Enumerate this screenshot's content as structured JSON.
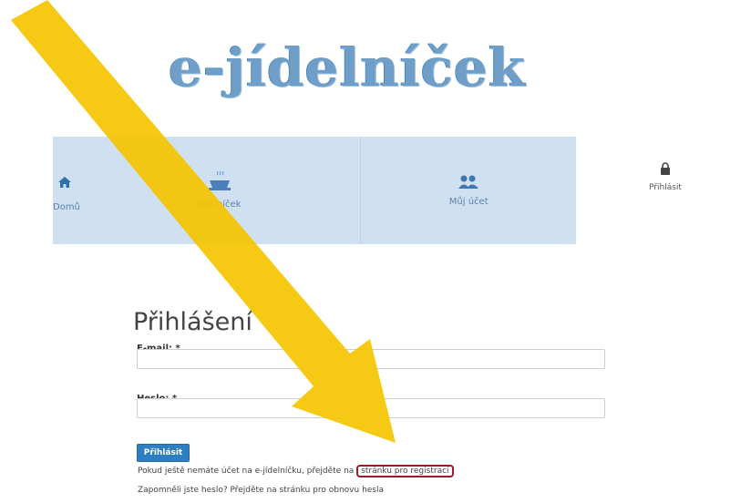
{
  "header": {
    "logo_text": "e-jídelníček"
  },
  "nav": {
    "items": [
      {
        "label": "Domů",
        "icon": "home-icon"
      },
      {
        "label": "Jídelníček",
        "icon": "dish-icon"
      },
      {
        "label": "Můj účet",
        "icon": "users-icon"
      }
    ],
    "login": {
      "label": "Přihlásit",
      "icon": "lock-icon"
    }
  },
  "form": {
    "title": "Přihlášení",
    "email_label": "E-mail: *",
    "email_value": "",
    "password_label": "Heslo: *",
    "password_value": "",
    "submit_label": "Přihlásit"
  },
  "footer": {
    "register_prefix": "Pokud ještě nemáte účet na e-jídelníčku, přejděte na",
    "register_link": "stránku pro registraci",
    "forgot_text": "Zapomněli jste heslo? Přejděte na stránku pro obnovu hesla"
  },
  "colors": {
    "accent": "#2f7ec2",
    "nav_bg": "#cfe0f1",
    "arrow": "#f5c400",
    "highlight": "#9a1b2a"
  }
}
